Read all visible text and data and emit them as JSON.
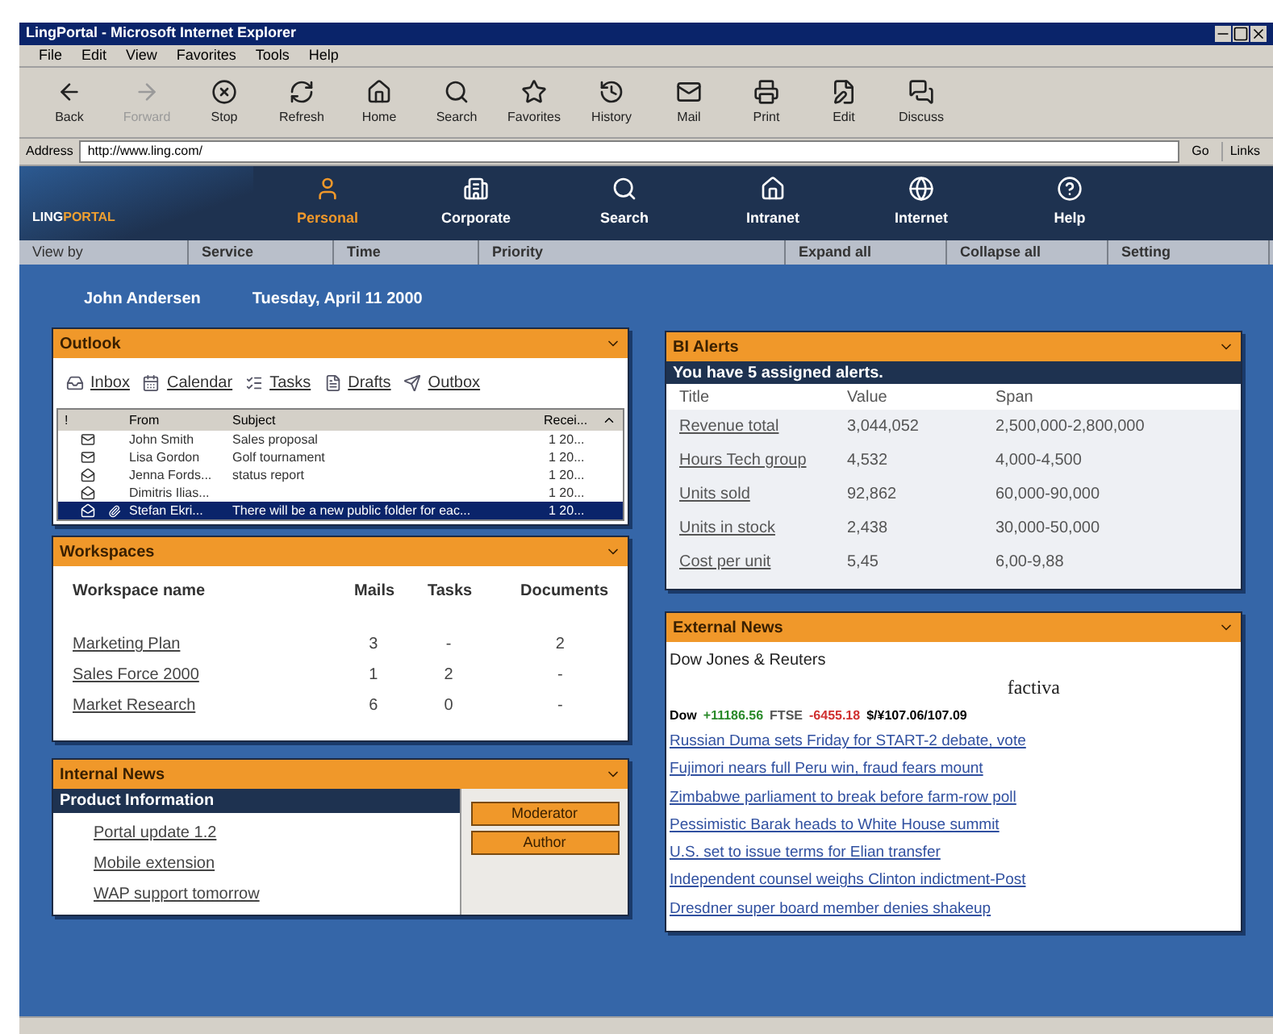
{
  "window": {
    "title": "LingPortal - Microsoft Internet Explorer"
  },
  "menu": [
    "File",
    "Edit",
    "View",
    "Favorites",
    "Tools",
    "Help"
  ],
  "toolbar": [
    {
      "label": "Back",
      "kind": "back",
      "disabled": false
    },
    {
      "label": "Forward",
      "kind": "forward",
      "disabled": true
    },
    {
      "label": "Stop",
      "kind": "stop",
      "disabled": false
    },
    {
      "label": "Refresh",
      "kind": "refresh",
      "disabled": false
    },
    {
      "label": "Home",
      "kind": "home",
      "disabled": false
    },
    {
      "label": "Search",
      "kind": "search",
      "disabled": false
    },
    {
      "label": "Favorites",
      "kind": "favorites",
      "disabled": false
    },
    {
      "label": "History",
      "kind": "history",
      "disabled": false
    },
    {
      "label": "Mail",
      "kind": "mail",
      "disabled": false
    },
    {
      "label": "Print",
      "kind": "print",
      "disabled": false
    },
    {
      "label": "Edit",
      "kind": "edit",
      "disabled": false
    },
    {
      "label": "Discuss",
      "kind": "discuss",
      "disabled": false
    }
  ],
  "address": {
    "label": "Address",
    "value": "http://www.ling.com/",
    "go": "Go",
    "links": "Links"
  },
  "portal": {
    "logo": [
      {
        "text": "LING",
        "color": "#ffffff"
      },
      {
        "text": "PORTAL",
        "color": "#f0a030"
      }
    ],
    "nav": [
      {
        "label": "Personal",
        "kind": "user",
        "selected": true
      },
      {
        "label": "Corporate",
        "kind": "building",
        "selected": false
      },
      {
        "label": "Search",
        "kind": "search",
        "selected": false
      },
      {
        "label": "Intranet",
        "kind": "house",
        "selected": false
      },
      {
        "label": "Internet",
        "kind": "globe",
        "selected": false
      },
      {
        "label": "Help",
        "kind": "help",
        "selected": false
      }
    ],
    "bar": [
      "View by",
      "Service",
      "Time",
      "Priority",
      "Expand all",
      "Collapse all",
      "Setting"
    ]
  },
  "user": {
    "name": "John Andersen",
    "date": "Tuesday, April 11 2000"
  },
  "outlook": {
    "title": "Outlook",
    "folders": [
      {
        "label": "Inbox",
        "kind": "inbox"
      },
      {
        "label": "Calendar",
        "kind": "calendar"
      },
      {
        "label": "Tasks",
        "kind": "tasks"
      },
      {
        "label": "Drafts",
        "kind": "drafts"
      },
      {
        "label": "Outbox",
        "kind": "outbox"
      }
    ],
    "columns": [
      "!",
      "From",
      "Subject",
      "Recei..."
    ],
    "rows": [
      {
        "kind": "unread",
        "attachment": false,
        "from": "John Smith",
        "subject": "Sales proposal",
        "received": "1 20...",
        "selected": false
      },
      {
        "kind": "unread",
        "attachment": false,
        "from": "Lisa Gordon",
        "subject": "Golf tournament",
        "received": "1 20...",
        "selected": false
      },
      {
        "kind": "read",
        "attachment": false,
        "from": "Jenna Fords...",
        "subject": "status report",
        "received": "1 20...",
        "selected": false
      },
      {
        "kind": "read",
        "attachment": false,
        "from": "Dimitris Ilias...",
        "subject": "",
        "received": "1 20...",
        "selected": false
      },
      {
        "kind": "read",
        "attachment": true,
        "from": "Stefan Ekri...",
        "subject": "There will be a new public folder for eac...",
        "received": "1 20...",
        "selected": true
      }
    ]
  },
  "workspaces": {
    "title": "Workspaces",
    "columns": [
      "Workspace name",
      "Mails",
      "Tasks",
      "Documents"
    ],
    "rows": [
      [
        "Marketing Plan",
        "3",
        "-",
        "2"
      ],
      [
        "Sales Force 2000",
        "1",
        "2",
        "-"
      ],
      [
        "Market Research",
        "6",
        "0",
        "-"
      ]
    ]
  },
  "internal_news": {
    "title": "Internal News",
    "section": "Product Information",
    "items": [
      "Portal update 1.2",
      "Mobile extension",
      "WAP support tomorrow"
    ],
    "buttons": [
      "Moderator",
      "Author"
    ]
  },
  "bi_alerts": {
    "title": "BI Alerts",
    "summary": "You have 5 assigned alerts.",
    "columns": [
      "Title",
      "Value",
      "Span"
    ],
    "rows": [
      [
        "Revenue total",
        "3,044,052",
        "2,500,000-2,800,000"
      ],
      [
        "Hours Tech group",
        "4,532",
        "4,000-4,500"
      ],
      [
        "Units sold",
        "92,862",
        "60,000-90,000"
      ],
      [
        "Units in stock",
        "2,438",
        "30,000-50,000"
      ],
      [
        "Cost per unit",
        "5,45",
        "6,00-9,88"
      ]
    ]
  },
  "external_news": {
    "title": "External News",
    "source": "Dow Jones & Reuters",
    "brand": "factiva",
    "ticker": [
      {
        "text": "Dow",
        "color": "#000000"
      },
      {
        "text": "+11186.56",
        "color": "#2a8a2a"
      },
      {
        "text": "FTSE",
        "color": "#555555"
      },
      {
        "text": "-6455.18",
        "color": "#d03030"
      },
      {
        "text": "$/¥107.06/107.09",
        "color": "#000000"
      }
    ],
    "headlines": [
      "Russian Duma sets Friday for START-2 debate, vote",
      "Fujimori nears full Peru win, fraud fears mount",
      "Zimbabwe parliament to break before farm-row poll",
      "Pessimistic Barak heads to White House summit",
      "U.S. set to issue terms for Elian transfer",
      "Independent counsel weighs Clinton indictment-Post",
      "Dresdner super board member denies shakeup"
    ]
  }
}
